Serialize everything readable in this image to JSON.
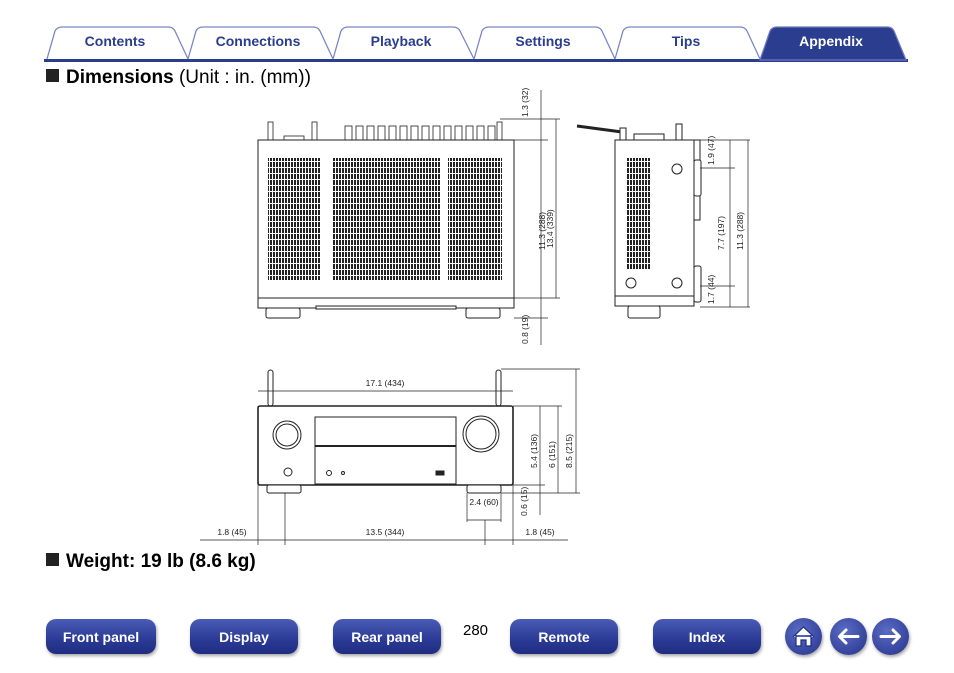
{
  "nav": {
    "tabs": [
      {
        "label": "Contents",
        "active": false
      },
      {
        "label": "Connections",
        "active": false
      },
      {
        "label": "Playback",
        "active": false
      },
      {
        "label": "Settings",
        "active": false
      },
      {
        "label": "Tips",
        "active": false
      },
      {
        "label": "Appendix",
        "active": true
      }
    ],
    "colors": {
      "tab_text": "#2a3d8f",
      "active_bg": "#2b3d8f",
      "border": "#2b3d8f"
    }
  },
  "dimensions": {
    "title": "Dimensions",
    "unit": "(Unit : in. (mm))",
    "top_view": {
      "rear_protrusion": "1.3 (32)",
      "body_depth": "11.3 (288)",
      "total_depth": "13.4 (339)",
      "front_protrusion": "0.8 (19)"
    },
    "side_view": {
      "top_to_foot": "1.9 (47)",
      "foot_spacing": "7.7 (197)",
      "body_depth": "11.3 (288)",
      "foot_to_front": "1.7 (44)"
    },
    "front_view": {
      "width": "17.1 (434)",
      "body_height": "5.4 (136)",
      "height_with_feet": "6 (151)",
      "height_with_antenna": "8.5 (215)",
      "foot_height": "0.6 (15)",
      "foot_width": "2.4 (60)",
      "left_offset": "1.8 (45)",
      "foot_spacing": "13.5 (344)",
      "right_offset": "1.8 (45)"
    }
  },
  "weight": {
    "title": "Weight: 19 lb (8.6 kg)"
  },
  "footer": {
    "buttons": [
      {
        "label": "Front panel"
      },
      {
        "label": "Display"
      },
      {
        "label": "Rear panel"
      },
      {
        "label": "Remote"
      },
      {
        "label": "Index"
      }
    ],
    "page_number": "280",
    "icons": [
      "home-icon",
      "arrow-left-icon",
      "arrow-right-icon"
    ]
  }
}
